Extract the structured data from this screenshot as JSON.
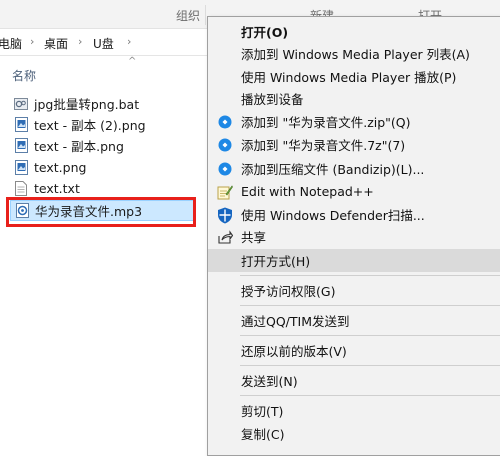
{
  "ribbon": {
    "groups": [
      "组织",
      "新建",
      "打开"
    ]
  },
  "address": {
    "crumbs": [
      "电脑",
      "桌面",
      "U盘"
    ]
  },
  "list": {
    "column_name": "名称",
    "files": [
      {
        "name": "jpg批量转png.bat",
        "icon": "bat-file-icon"
      },
      {
        "name": "text - 副本 (2).png",
        "icon": "image-file-icon"
      },
      {
        "name": "text - 副本.png",
        "icon": "image-file-icon"
      },
      {
        "name": "text.png",
        "icon": "image-file-icon"
      },
      {
        "name": "text.txt",
        "icon": "text-file-icon"
      },
      {
        "name": "华为录音文件.mp3",
        "icon": "audio-file-icon",
        "selected": true
      }
    ]
  },
  "context_menu": {
    "items": [
      {
        "label": "打开(O)",
        "bold": true,
        "icon": null
      },
      {
        "label": "添加到 Windows Media Player 列表(A)",
        "icon": null
      },
      {
        "label": "使用 Windows Media Player 播放(P)",
        "icon": null
      },
      {
        "label": "播放到设备",
        "icon": null
      },
      {
        "label": "添加到 \"华为录音文件.zip\"(Q)",
        "icon": "bandizip-icon"
      },
      {
        "label": "添加到 \"华为录音文件.7z\"(7)",
        "icon": "bandizip-icon"
      },
      {
        "label": "添加到压缩文件 (Bandizip)(L)...",
        "icon": "bandizip-icon"
      },
      {
        "label": "Edit with Notepad++",
        "icon": "notepadpp-icon"
      },
      {
        "label": "使用 Windows Defender扫描...",
        "icon": "defender-shield-icon"
      },
      {
        "label": "共享",
        "icon": "share-icon"
      },
      {
        "label": "打开方式(H)",
        "icon": null,
        "hover": true
      },
      {
        "label": "授予访问权限(G)",
        "icon": null
      },
      {
        "label": "通过QQ/TIM发送到",
        "icon": null
      },
      {
        "label": "还原以前的版本(V)",
        "icon": null
      },
      {
        "label": "发送到(N)",
        "icon": null
      },
      {
        "label": "剪切(T)",
        "icon": null
      },
      {
        "label": "复制(C)",
        "icon": null
      }
    ]
  },
  "colors": {
    "selection_bg": "#cce8ff",
    "highlight_border": "#e8201b",
    "menu_bg": "#f2f2f2",
    "menu_hover": "#dadada",
    "bandizip_blue": "#1e88e5"
  }
}
